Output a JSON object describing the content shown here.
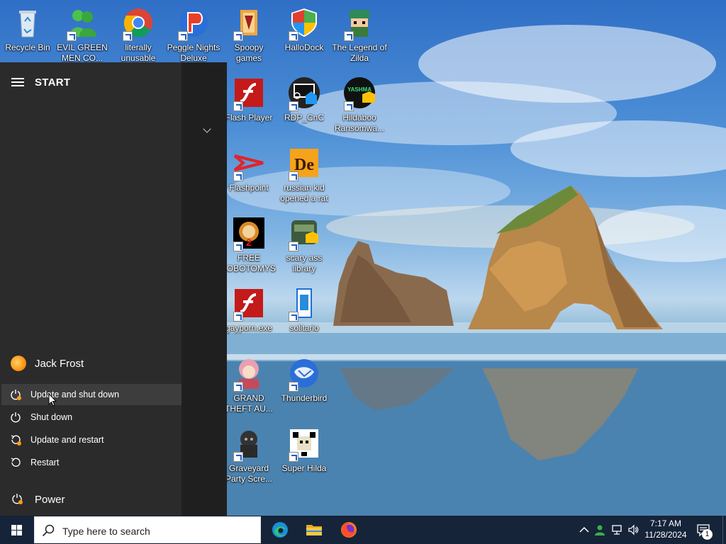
{
  "desktop": {
    "icons": [
      {
        "label": "Recycle Bin",
        "icon": "recycle-bin-icon"
      },
      {
        "label": "EVIL GREEN MEN CO...",
        "icon": "green-men-icon"
      },
      {
        "label": "literally unusable",
        "icon": "chrome-icon"
      },
      {
        "label": "Peggle Nights Deluxe",
        "icon": "peggle-icon"
      },
      {
        "label": "Spoopy games",
        "icon": "folder-icon"
      },
      {
        "label": "HalloDock",
        "icon": "shield-icon"
      },
      {
        "label": "The Legend of Zilda",
        "icon": "zilda-icon"
      },
      {
        "label": "Flash Player",
        "icon": "flash-icon"
      },
      {
        "label": "RDP_CnC",
        "icon": "rdp-icon"
      },
      {
        "label": "Hildaboo Ransomwa...",
        "icon": "yashma-icon"
      },
      {
        "label": "Flashpoint",
        "icon": "flashpoint-icon"
      },
      {
        "label": "russian kid opened a rat",
        "icon": "de-icon"
      },
      {
        "label": "FREE LOBOTOMYS",
        "icon": "lobotomy-icon"
      },
      {
        "label": "scary ass library",
        "icon": "library-icon"
      },
      {
        "label": "gayporn.exe",
        "icon": "flash-icon"
      },
      {
        "label": "solitario",
        "icon": "solitaire-icon"
      },
      {
        "label": "GRAND THEFT AU...",
        "icon": "anime-girl-icon"
      },
      {
        "label": "Thunderbird",
        "icon": "thunderbird-icon"
      },
      {
        "label": "Graveyard Party Scre...",
        "icon": "graveyard-icon"
      },
      {
        "label": "Super Hilda",
        "icon": "dog-pixel-icon"
      }
    ]
  },
  "start_menu": {
    "title": "START",
    "user_name": "Jack Frost",
    "power_options": [
      {
        "label": "Update and shut down",
        "icon": "power-update-icon"
      },
      {
        "label": "Shut down",
        "icon": "power-icon"
      },
      {
        "label": "Update and restart",
        "icon": "restart-update-icon"
      },
      {
        "label": "Restart",
        "icon": "restart-icon"
      }
    ],
    "power_label": "Power"
  },
  "taskbar": {
    "search_placeholder": "Type here to search",
    "apps": [
      "edge-icon",
      "file-explorer-icon",
      "firefox-icon"
    ],
    "time": "7:17 AM",
    "date": "11/28/2024",
    "notification_count": "1"
  },
  "colors": {
    "taskbar": "#16243a",
    "start_bg": "#2b2b2b",
    "accent_orange": "#ff9a1a"
  }
}
